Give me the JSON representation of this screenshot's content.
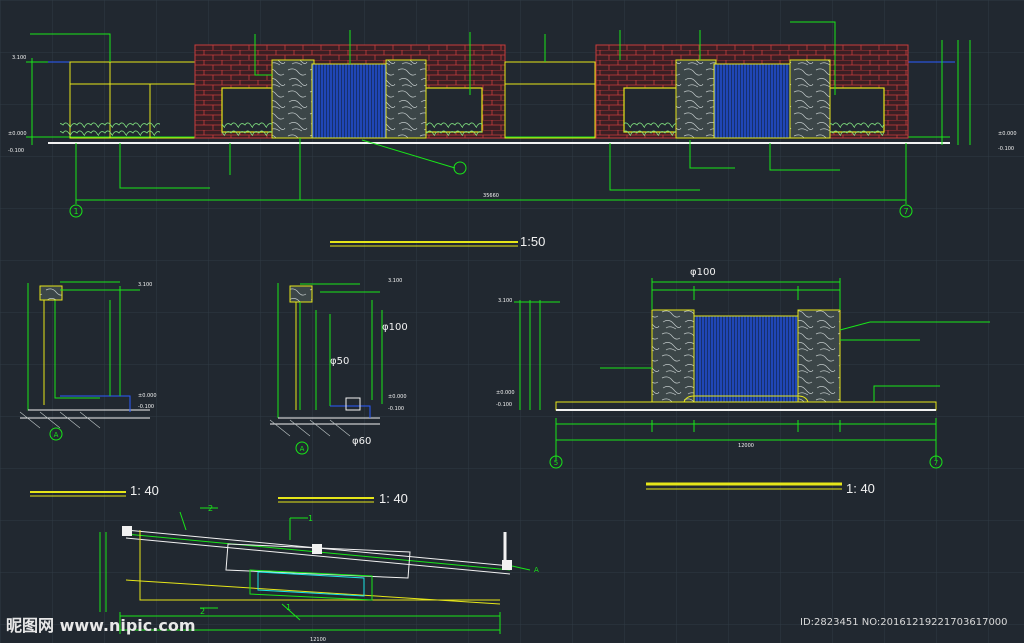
{
  "scales": {
    "main": "1:50",
    "sec_a": "1: 40",
    "sec_b": "1: 40",
    "detail": "1: 40"
  },
  "dims": {
    "overall": "35660",
    "phi100_top": "φ100",
    "phi100_mid": "φ100",
    "phi50": "φ50",
    "phi60": "φ60",
    "grid_left": "1",
    "grid_right": "7",
    "grid_d_left": "5",
    "grid_d_right": "7",
    "sec_mark": "A",
    "plan_mark_1": "1",
    "plan_mark_2": "2",
    "elev_minus": "-0.100",
    "elev_zero": "±0.000",
    "elev_top": "3.100",
    "detail_total": "12000",
    "plan_total": "12100"
  },
  "watermark": {
    "logo": "昵图网 www.nipic.com",
    "id": "ID:2823451 NO:20161219221703617000"
  },
  "colors": {
    "background": "#212830",
    "grid": "#2f3a44",
    "green": "#19e619",
    "yellow": "#e6e619",
    "white": "#f2f2f2",
    "brick": "#c83c3c",
    "water": "#2a5cff",
    "cyan": "#19e6e6"
  }
}
